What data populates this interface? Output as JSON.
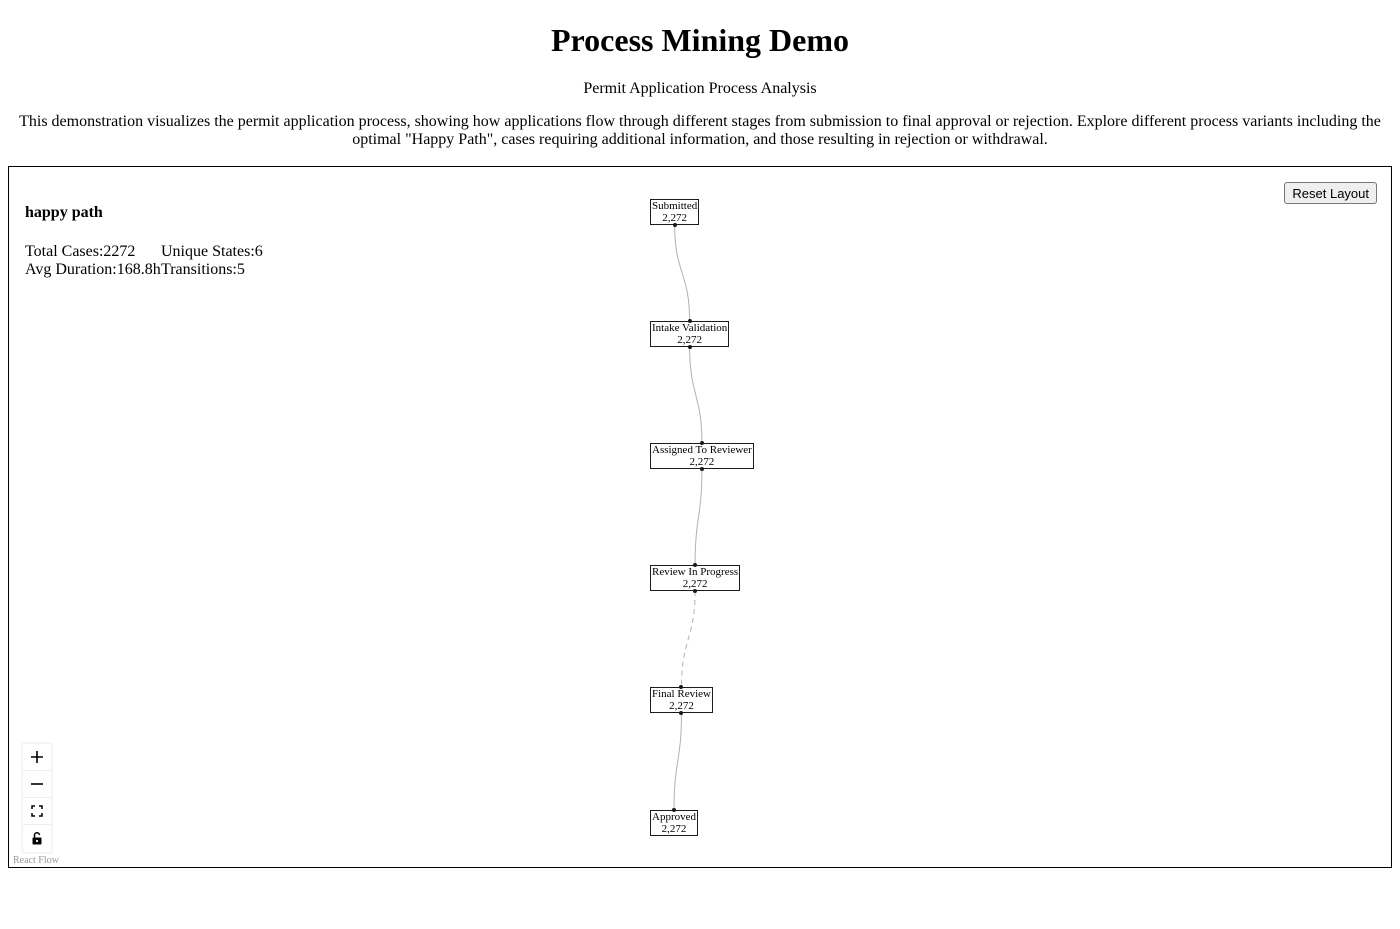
{
  "header": {
    "title": "Process Mining Demo",
    "subtitle": "Permit Application Process Analysis",
    "description": "This demonstration visualizes the permit application process, showing how applications flow through different stages from submission to final approval or rejection. Explore different process variants including the optimal \"Happy Path\", cases requiring additional information, and those resulting in rejection or withdrawal."
  },
  "panel": {
    "variant_name": "happy path",
    "stats": {
      "total_cases_label": "Total Cases:",
      "total_cases_value": "2272",
      "unique_states_label": "Unique States:",
      "unique_states_value": "6",
      "avg_duration_label": "Avg Duration:",
      "avg_duration_value": "168.8h",
      "transitions_label": "Transitions:",
      "transitions_value": "5"
    },
    "reset_label": "Reset Layout",
    "attribution": "React Flow"
  },
  "nodes": [
    {
      "label": "Submitted",
      "count": "2,272"
    },
    {
      "label": "Intake Validation",
      "count": "2,272"
    },
    {
      "label": "Assigned To Reviewer",
      "count": "2,272"
    },
    {
      "label": "Review In Progress",
      "count": "2,272"
    },
    {
      "label": "Final Review",
      "count": "2,272"
    },
    {
      "label": "Approved",
      "count": "2,272"
    }
  ],
  "edges": [
    {
      "from": "Submitted",
      "to": "Intake Validation",
      "style": "solid"
    },
    {
      "from": "Intake Validation",
      "to": "Assigned To Reviewer",
      "style": "solid"
    },
    {
      "from": "Assigned To Reviewer",
      "to": "Review In Progress",
      "style": "solid"
    },
    {
      "from": "Review In Progress",
      "to": "Final Review",
      "style": "dashed"
    },
    {
      "from": "Final Review",
      "to": "Approved",
      "style": "solid"
    }
  ],
  "controls": [
    {
      "name": "zoom-in-icon"
    },
    {
      "name": "zoom-out-icon"
    },
    {
      "name": "fit-view-icon"
    },
    {
      "name": "lock-icon"
    }
  ],
  "colors": {
    "edge": "#b1b1b7",
    "node_border": "#1a1a1a",
    "panel_border": "#000000"
  }
}
